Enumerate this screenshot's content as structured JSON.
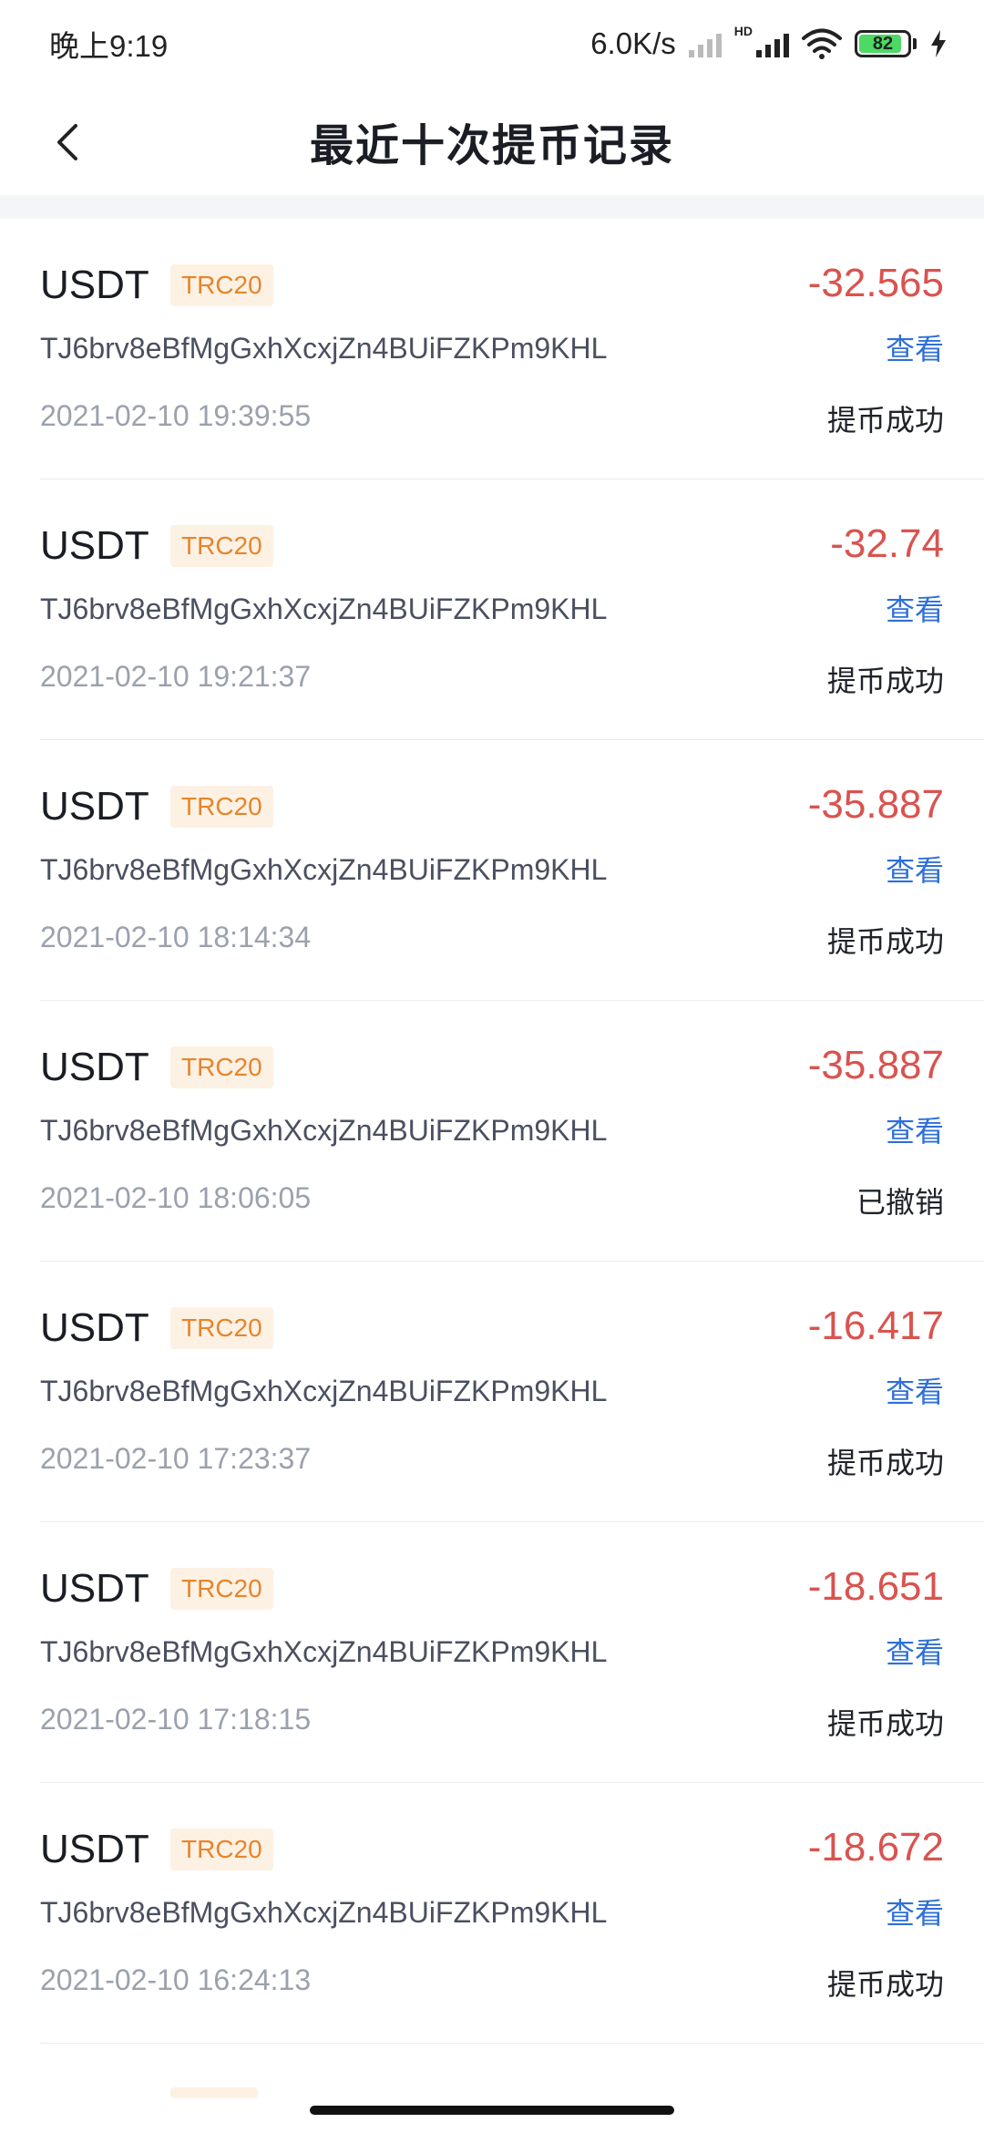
{
  "status_bar": {
    "time": "晚上9:19",
    "net_speed": "6.0K/s",
    "hd": "HD",
    "battery": "82"
  },
  "header": {
    "title": "最近十次提币记录"
  },
  "records": [
    {
      "asset": "USDT",
      "chain": "TRC20",
      "address": "TJ6brv8eBfMgGxhXcxjZn4BUiFZKPm9KHL",
      "time": "2021-02-10 19:39:55",
      "amount": "-32.565",
      "view": "查看",
      "status": "提币成功"
    },
    {
      "asset": "USDT",
      "chain": "TRC20",
      "address": "TJ6brv8eBfMgGxhXcxjZn4BUiFZKPm9KHL",
      "time": "2021-02-10 19:21:37",
      "amount": "-32.74",
      "view": "查看",
      "status": "提币成功"
    },
    {
      "asset": "USDT",
      "chain": "TRC20",
      "address": "TJ6brv8eBfMgGxhXcxjZn4BUiFZKPm9KHL",
      "time": "2021-02-10 18:14:34",
      "amount": "-35.887",
      "view": "查看",
      "status": "提币成功"
    },
    {
      "asset": "USDT",
      "chain": "TRC20",
      "address": "TJ6brv8eBfMgGxhXcxjZn4BUiFZKPm9KHL",
      "time": "2021-02-10 18:06:05",
      "amount": "-35.887",
      "view": "查看",
      "status": "已撤销"
    },
    {
      "asset": "USDT",
      "chain": "TRC20",
      "address": "TJ6brv8eBfMgGxhXcxjZn4BUiFZKPm9KHL",
      "time": "2021-02-10 17:23:37",
      "amount": "-16.417",
      "view": "查看",
      "status": "提币成功"
    },
    {
      "asset": "USDT",
      "chain": "TRC20",
      "address": "TJ6brv8eBfMgGxhXcxjZn4BUiFZKPm9KHL",
      "time": "2021-02-10 17:18:15",
      "amount": "-18.651",
      "view": "查看",
      "status": "提币成功"
    },
    {
      "asset": "USDT",
      "chain": "TRC20",
      "address": "TJ6brv8eBfMgGxhXcxjZn4BUiFZKPm9KHL",
      "time": "2021-02-10 16:24:13",
      "amount": "-18.672",
      "view": "查看",
      "status": "提币成功"
    }
  ]
}
